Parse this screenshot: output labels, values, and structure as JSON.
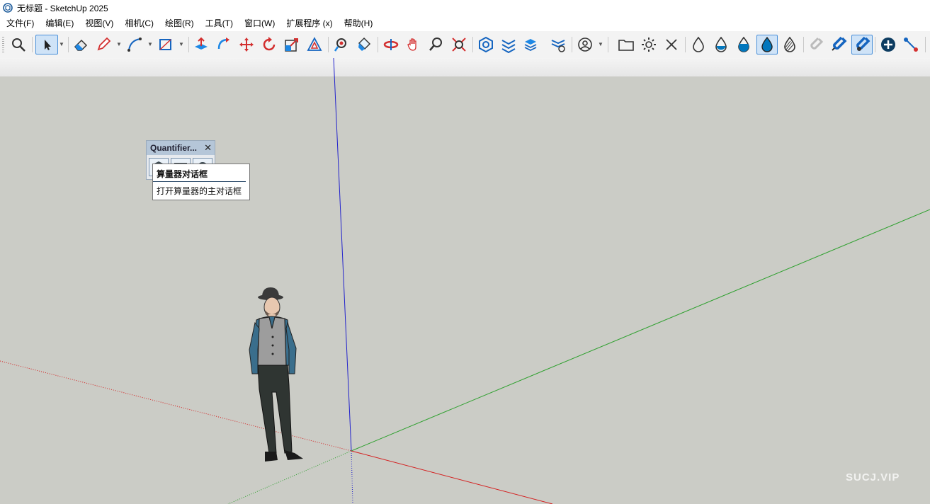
{
  "window": {
    "title": "无标题 - SketchUp 2025",
    "app_icon": "sketchup-logo-icon"
  },
  "menubar": {
    "items": [
      {
        "label": "文件(F)"
      },
      {
        "label": "编辑(E)"
      },
      {
        "label": "视图(V)"
      },
      {
        "label": "相机(C)"
      },
      {
        "label": "绘图(R)"
      },
      {
        "label": "工具(T)"
      },
      {
        "label": "窗口(W)"
      },
      {
        "label": "扩展程序 (x)"
      },
      {
        "label": "帮助(H)"
      }
    ]
  },
  "toolbar": {
    "active_tools": [
      "select-tool",
      "drop-filled-icon",
      "magnet-active-icon"
    ]
  },
  "quantifier_panel": {
    "title": "Quantifier...",
    "close_icon": "close-icon",
    "buttons": [
      "quantifier-open-icon",
      "quantifier-report-icon",
      "quantifier-settings-icon"
    ]
  },
  "tooltip": {
    "title": "算量器对话框",
    "description": "打开算量器的主对话框"
  },
  "viewport": {
    "background_color": "#cbccc6",
    "axis_colors": {
      "red": "#d42020",
      "green": "#2ea02e",
      "blue": "#2020c8"
    },
    "figure": "scale-figure-man-with-hat"
  },
  "watermark": {
    "text": "SUCJ.VIP"
  }
}
